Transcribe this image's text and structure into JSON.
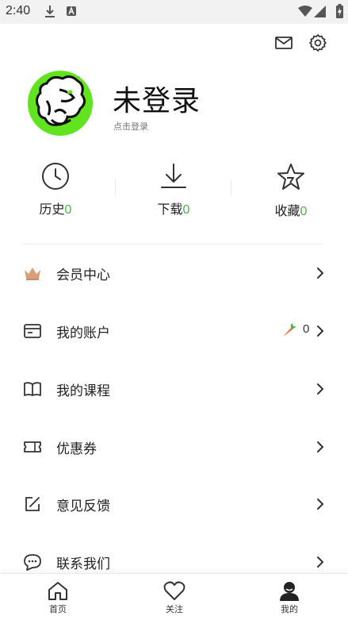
{
  "status_bar": {
    "time": "2:40"
  },
  "profile": {
    "username": "未登录",
    "login_hint": "点击登录"
  },
  "stats": [
    {
      "label": "历史",
      "count": "0",
      "icon": "clock-icon"
    },
    {
      "label": "下载",
      "count": "0",
      "icon": "download-icon"
    },
    {
      "label": "收藏",
      "count": "0",
      "icon": "star-icon"
    }
  ],
  "menu": [
    {
      "label": "会员中心",
      "icon": "crown-icon"
    },
    {
      "label": "我的账户",
      "icon": "wallet-icon",
      "balance": "0"
    },
    {
      "label": "我的课程",
      "icon": "book-icon"
    },
    {
      "label": "优惠券",
      "icon": "coupon-icon"
    },
    {
      "label": "意见反馈",
      "icon": "edit-icon"
    },
    {
      "label": "联系我们",
      "icon": "chat-icon"
    }
  ],
  "bottom_nav": [
    {
      "label": "首页",
      "icon": "home-icon"
    },
    {
      "label": "关注",
      "icon": "heart-icon"
    },
    {
      "label": "我的",
      "icon": "user-icon"
    }
  ],
  "colors": {
    "accent": "#4cb34a",
    "avatar_bg": "#62e31f",
    "crown": "#d8a07a",
    "carrot": "#f0702a"
  }
}
